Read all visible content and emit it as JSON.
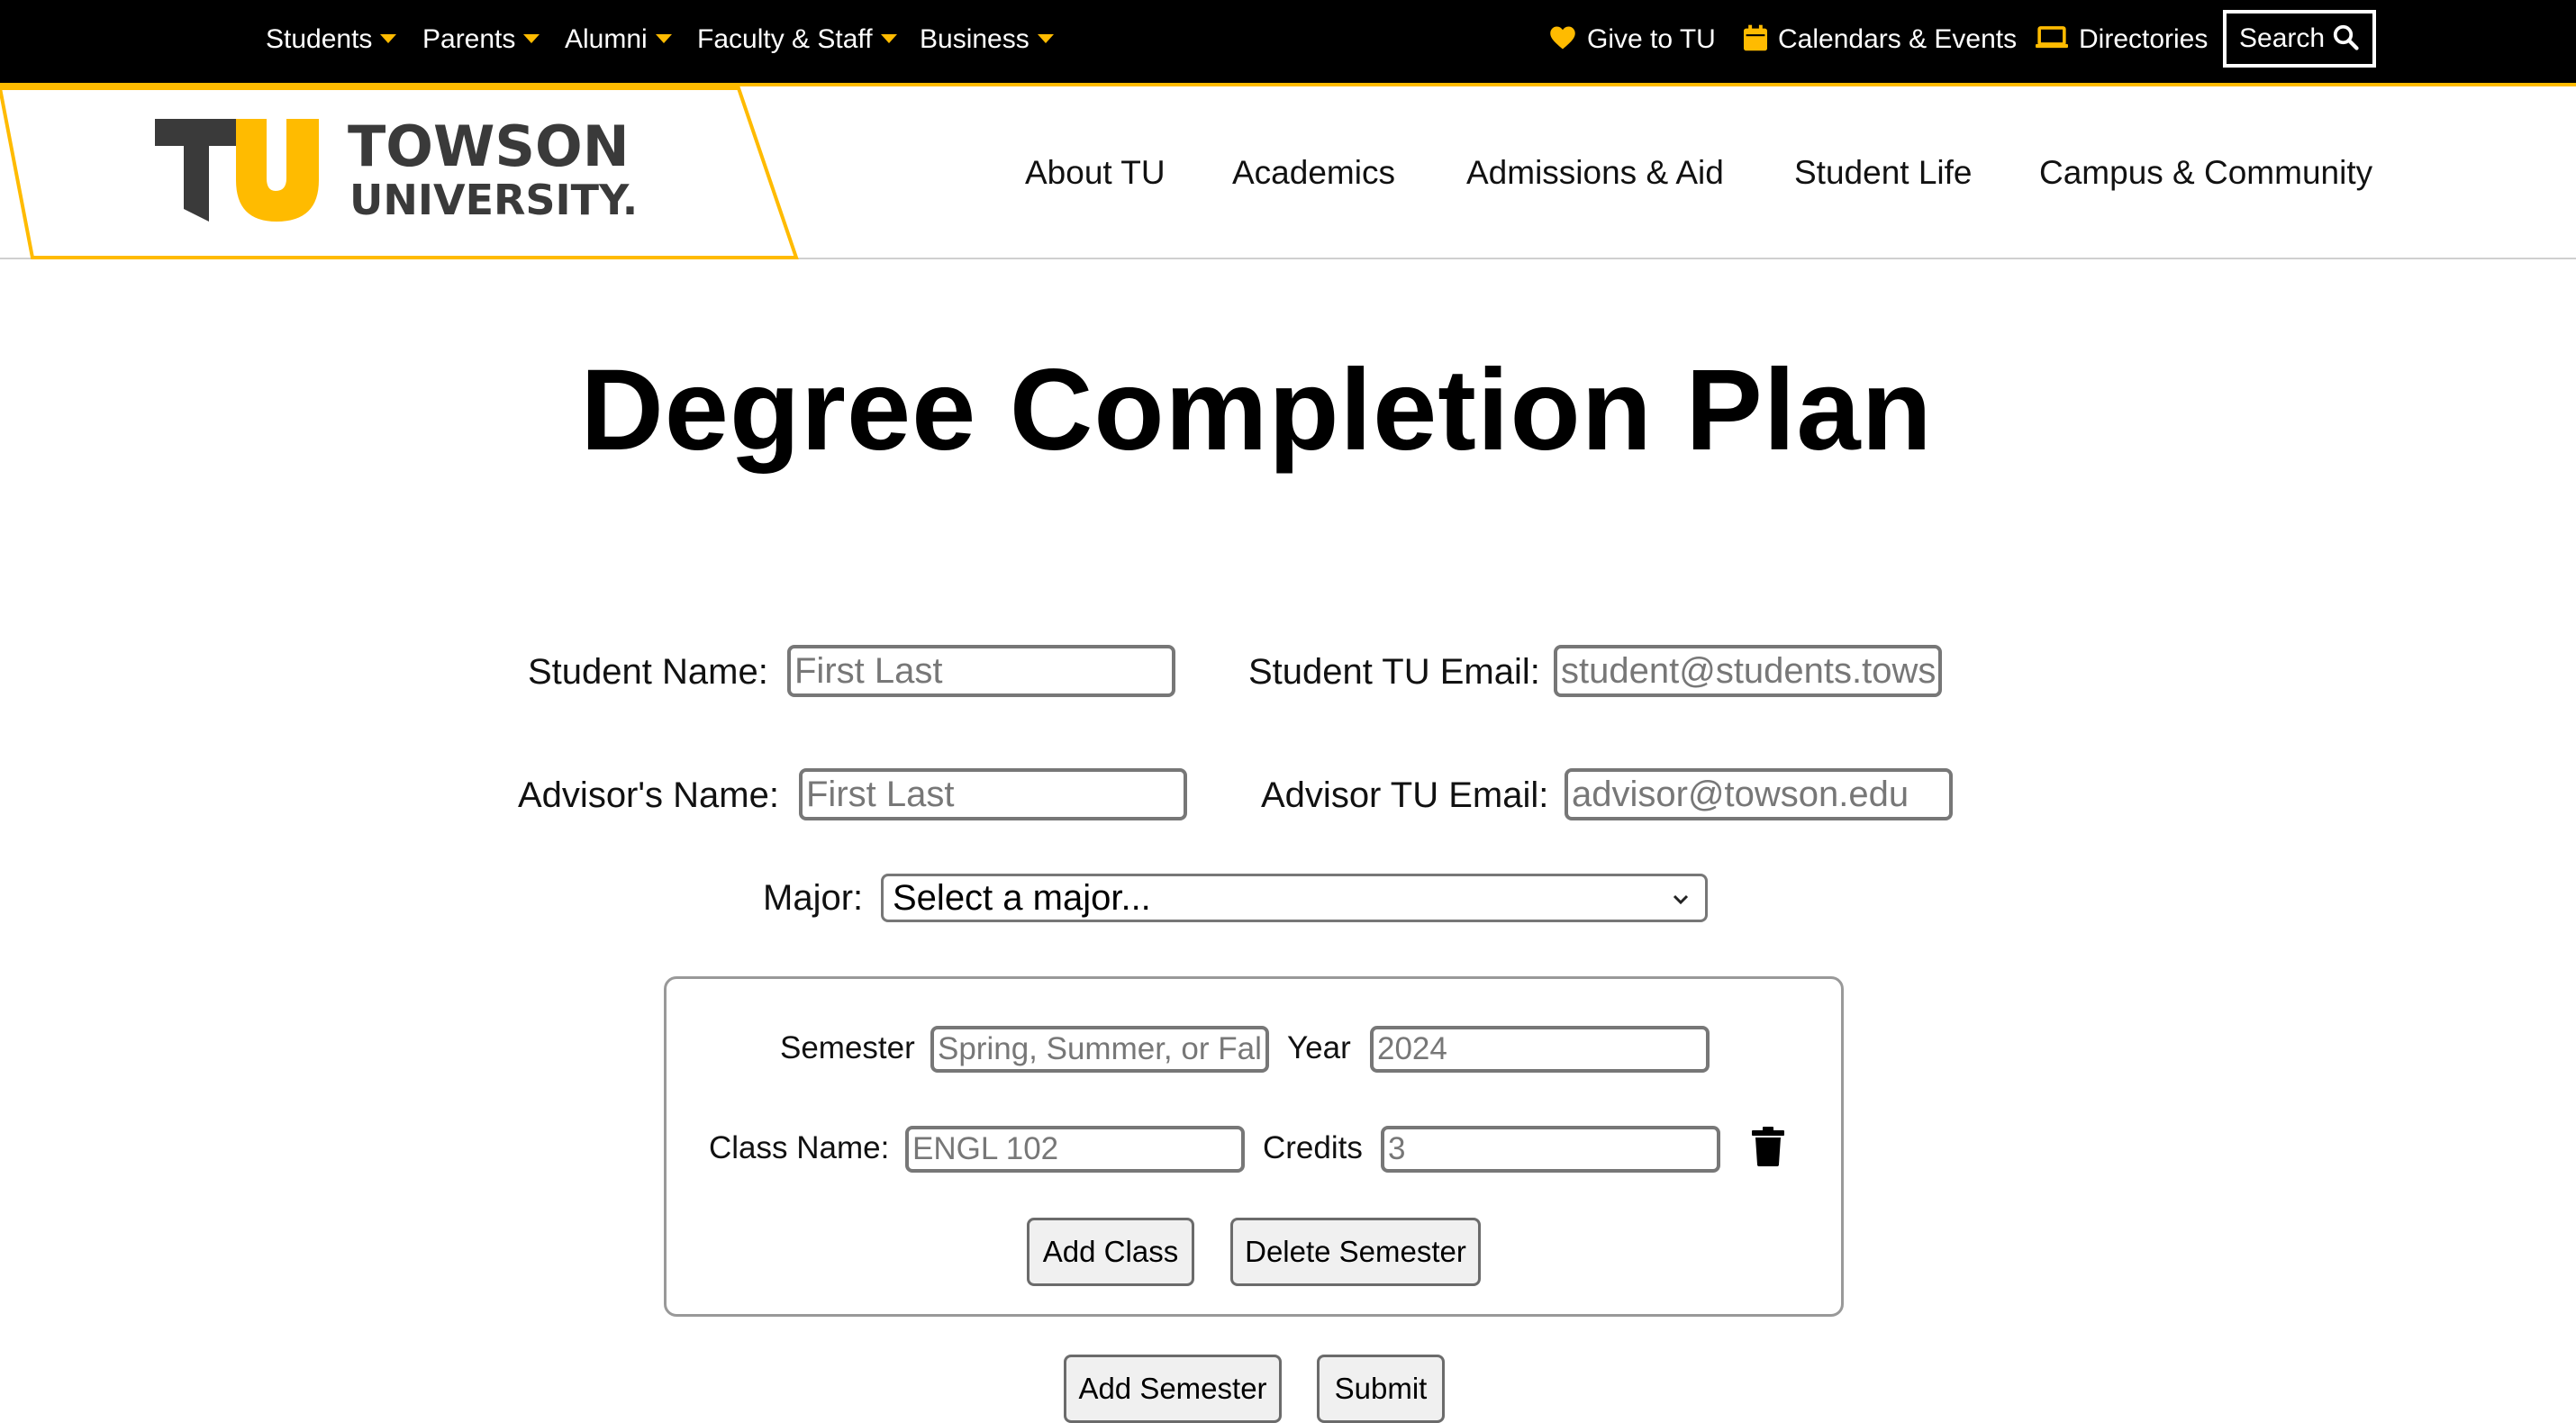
{
  "utility_nav": {
    "audiences": [
      {
        "label": "Students"
      },
      {
        "label": "Parents"
      },
      {
        "label": "Alumni"
      },
      {
        "label": "Faculty & Staff"
      },
      {
        "label": "Business"
      }
    ],
    "give_label": "Give to TU",
    "calendars_label": "Calendars & Events",
    "directories_label": "Directories",
    "search_label": "Search"
  },
  "brand": {
    "logo_mark": "TU",
    "name_line1": "TOWSON",
    "name_line2": "UNIVERSITY.",
    "accent_color": "#ffbb00"
  },
  "main_nav": {
    "items": [
      {
        "label": "About TU"
      },
      {
        "label": "Academics"
      },
      {
        "label": "Admissions & Aid"
      },
      {
        "label": "Student Life"
      },
      {
        "label": "Campus & Community"
      }
    ]
  },
  "page": {
    "title": "Degree Completion Plan"
  },
  "form": {
    "student_name": {
      "label": "Student Name:",
      "placeholder": "First Last",
      "value": ""
    },
    "student_email": {
      "label": "Student TU Email:",
      "placeholder": "student@students.towson.edu",
      "value": ""
    },
    "advisor_name": {
      "label": "Advisor's Name:",
      "placeholder": "First Last",
      "value": ""
    },
    "advisor_email": {
      "label": "Advisor TU Email:",
      "placeholder": "advisor@towson.edu",
      "value": ""
    },
    "major": {
      "label": "Major:",
      "selected": "Select a major..."
    }
  },
  "semester": {
    "semester_label": "Semester",
    "semester_placeholder": "Spring, Summer, or Fall",
    "year_label": "Year",
    "year_placeholder": "2024",
    "class_label": "Class Name:",
    "class_placeholder": "ENGL 102",
    "credits_label": "Credits",
    "credits_placeholder": "3",
    "add_class_label": "Add Class",
    "delete_semester_label": "Delete Semester",
    "delete_class_icon": "trash-icon"
  },
  "actions": {
    "add_semester_label": "Add Semester",
    "submit_label": "Submit"
  }
}
